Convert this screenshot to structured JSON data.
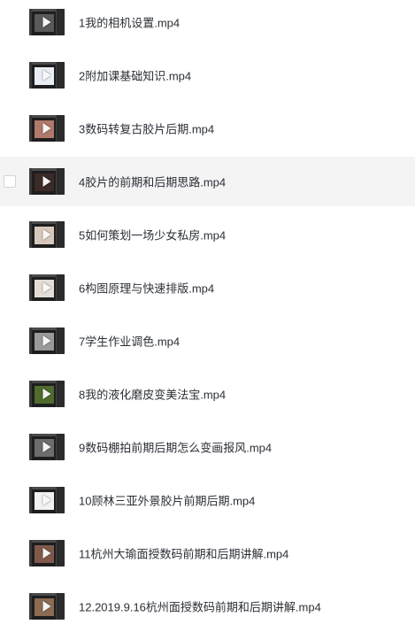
{
  "files": [
    {
      "name": "1我的相机设置.mp4",
      "photo_color": "#5a5a5a"
    },
    {
      "name": "2附加课基础知识.mp4",
      "photo_color": "#e9eef5"
    },
    {
      "name": "3数码转复古胶片后期.mp4",
      "photo_color": "#b07a6a"
    },
    {
      "name": "4胶片的前期和后期思路.mp4",
      "photo_color": "#3b2a26"
    },
    {
      "name": "5如何策划一场少女私房.mp4",
      "photo_color": "#d8c8bc"
    },
    {
      "name": "6构图原理与快速排版.mp4",
      "photo_color": "#e3ddd5"
    },
    {
      "name": "7学生作业调色.mp4",
      "photo_color": "#9a9a9a"
    },
    {
      "name": "8我的液化磨皮变美法宝.mp4",
      "photo_color": "#4f6b2e"
    },
    {
      "name": "9数码棚拍前期后期怎么变画报风.mp4",
      "photo_color": "#6d6d6d"
    },
    {
      "name": "10顾林三亚外景胶片前期后期.mp4",
      "photo_color": "#f2f2f2"
    },
    {
      "name": "11杭州大瑜面授数码前期和后期讲解.mp4",
      "photo_color": "#7f5a4b"
    },
    {
      "name": "12.2019.9.16杭州面授数码前期和后期讲解.mp4",
      "photo_color": "#8c6b52"
    }
  ],
  "hovered_index": 3
}
